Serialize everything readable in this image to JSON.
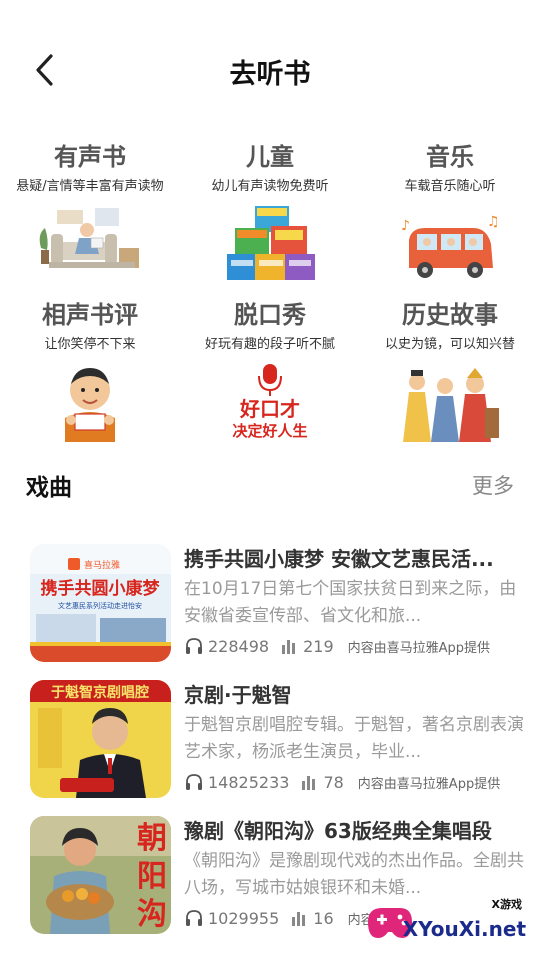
{
  "header": {
    "title": "去听书"
  },
  "categories": [
    {
      "title": "有声书",
      "subtitle": "悬疑/言情等丰富有声读物",
      "icon": "reading-person-icon"
    },
    {
      "title": "儿童",
      "subtitle": "幼儿有声读物免费听",
      "icon": "children-books-icon"
    },
    {
      "title": "音乐",
      "subtitle": "车载音乐随心听",
      "icon": "music-car-icon"
    },
    {
      "title": "相声书评",
      "subtitle": "让你笑停不下来",
      "icon": "comedian-icon"
    },
    {
      "title": "脱口秀",
      "subtitle": "好玩有趣的段子听不腻",
      "icon": "microphone-icon"
    },
    {
      "title": "历史故事",
      "subtitle": "以史为镜，可以知兴替",
      "icon": "ancient-figures-icon"
    }
  ],
  "cat_talkshow_art": {
    "line1": "好口才",
    "line2": "决定好人生"
  },
  "section": {
    "title": "戏曲",
    "more": "更多"
  },
  "items": [
    {
      "title": "携手共圆小康梦 安徽文艺惠民活...",
      "desc": "在10月17日第七个国家扶贫日到来之际，由安徽省委宣传部、省文化和旅...",
      "plays": "228498",
      "tracks": "219",
      "source": "内容由喜马拉雅App提供",
      "thumb": {
        "logo": "喜马拉雅",
        "headline": "携手共圆小康梦",
        "sub": "文艺惠民系列活动走进怡安"
      }
    },
    {
      "title": "京剧·于魁智",
      "desc": "于魁智京剧唱腔专辑。于魁智，著名京剧表演艺术家，杨派老生演员，毕业...",
      "plays": "14825233",
      "tracks": "78",
      "source": "内容由喜马拉雅App提供",
      "thumb": {
        "headline": "于魁智京剧唱腔"
      }
    },
    {
      "title": "豫剧《朝阳沟》63版经典全集唱段",
      "desc": "《朝阳沟》是豫剧现代戏的杰出作品。全剧共八场，写城市姑娘银环和未婚...",
      "plays": "1029955",
      "tracks": "16",
      "source": "内容由",
      "thumb": {
        "c1": "朝",
        "c2": "阳",
        "c3": "沟"
      }
    }
  ],
  "watermark": {
    "small": "X游戏",
    "big": "XYouXi.net"
  },
  "colors": {
    "accent_red": "#d7261e",
    "title_gray": "#555555",
    "desc_gray": "#9a9a9a"
  }
}
